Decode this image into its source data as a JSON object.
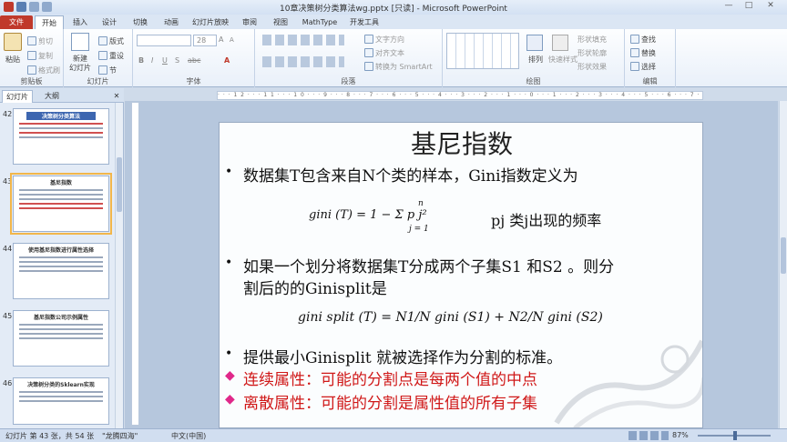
{
  "window": {
    "title": "10章决策树分类算法wg.pptx [只读] - Microsoft PowerPoint",
    "controls": [
      "—",
      "□",
      "✕"
    ]
  },
  "tabs": [
    "文件",
    "开始",
    "插入",
    "设计",
    "切换",
    "动画",
    "幻灯片放映",
    "审阅",
    "视图",
    "MathType",
    "开发工具"
  ],
  "ribbon": {
    "clipboard": {
      "paste": "粘贴",
      "cut": "剪切",
      "copy": "复制",
      "format_painter": "格式刷",
      "label": "剪贴板"
    },
    "slides": {
      "new_slide": "新建\n幻灯片",
      "layout": "版式",
      "reset": "重设",
      "section": "节",
      "label": "幻灯片"
    },
    "font": {
      "size": "28",
      "label": "字体"
    },
    "paragraph": {
      "text_direction": "文字方向",
      "align_text": "对齐文本",
      "convert_smartart": "转换为 SmartArt",
      "label": "段落"
    },
    "drawing": {
      "arrange": "排列",
      "quick_styles": "快速样式",
      "shape_fill": "形状填充",
      "shape_outline": "形状轮廓",
      "shape_effects": "形状效果",
      "label": "绘图"
    },
    "editing": {
      "find": "查找",
      "replace": "替换",
      "select": "选择",
      "label": "编辑"
    }
  },
  "panel": {
    "tab_slides": "幻灯片",
    "tab_outline": "大纲",
    "thumbnails": [
      {
        "num": "42",
        "title": "决策树分类算法"
      },
      {
        "num": "43",
        "title": "基尼指数"
      },
      {
        "num": "44",
        "title": "使用基尼指数进行属性选择"
      },
      {
        "num": "45",
        "title": "基尼指数公司示例属性"
      },
      {
        "num": "46",
        "title": "决策树分类的Sklearn实现"
      }
    ]
  },
  "slide": {
    "title": "基尼指数",
    "bullet1": "数据集T包含来自N个类的样本，Gini指数定义为",
    "formula1": "gini (T) = 1 − Σ p j²",
    "formula1_sum_top": "n",
    "formula1_sum_bottom": "j = 1",
    "pj_note": "pj 类j出现的频率",
    "bullet2_line1": "如果一个划分将数据集T分成两个子集S1 和S2 。则分",
    "bullet2_line2": "割后的的Ginisplit是",
    "formula2": "gini split (T) = N1/N gini (S1) + N2/N gini (S2)",
    "bullet3": "提供最小Ginisplit 就被选择作为分割的标准。",
    "red1": "连续属性：可能的分割点是每两个值的中点",
    "red2": "离散属性：可能的分割是属性值的所有子集"
  },
  "status": {
    "slide_info": "幻灯片 第 43 张，共 54 张",
    "theme": "\"龙腾四海\"",
    "language": "中文(中国)",
    "zoom": "87%"
  }
}
